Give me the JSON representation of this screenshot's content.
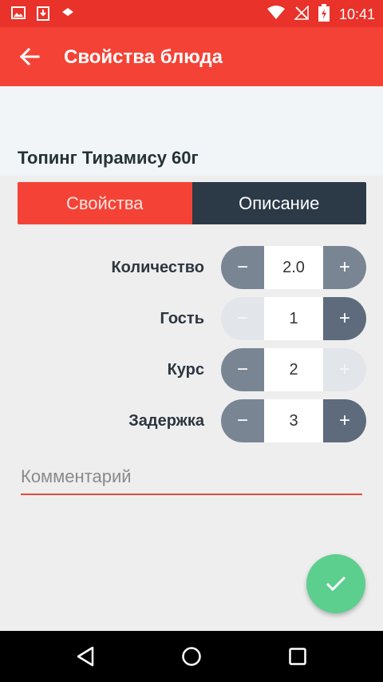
{
  "status_bar": {
    "time": "10:41"
  },
  "app_bar": {
    "title": "Свойства блюда"
  },
  "product": {
    "name": "Топинг Тирамису 60г"
  },
  "tabs": [
    {
      "label": "Свойства",
      "active": true
    },
    {
      "label": "Описание",
      "active": false
    }
  ],
  "fields": [
    {
      "label": "Количество",
      "value": "2.0",
      "minus_enabled": true,
      "plus_enabled": true
    },
    {
      "label": "Гость",
      "value": "1",
      "minus_enabled": false,
      "plus_enabled": true
    },
    {
      "label": "Курс",
      "value": "2",
      "minus_enabled": true,
      "plus_enabled": false
    },
    {
      "label": "Задержка",
      "value": "3",
      "minus_enabled": true,
      "plus_enabled": true
    }
  ],
  "stepper": {
    "minus_symbol": "−",
    "plus_symbol": "+"
  },
  "comment": {
    "placeholder": "Комментарий",
    "value": ""
  },
  "colors": {
    "accent": "#f44336",
    "dark_tab": "#2c3947",
    "fab": "#5ccf8f",
    "stepper": "#7a8594"
  }
}
